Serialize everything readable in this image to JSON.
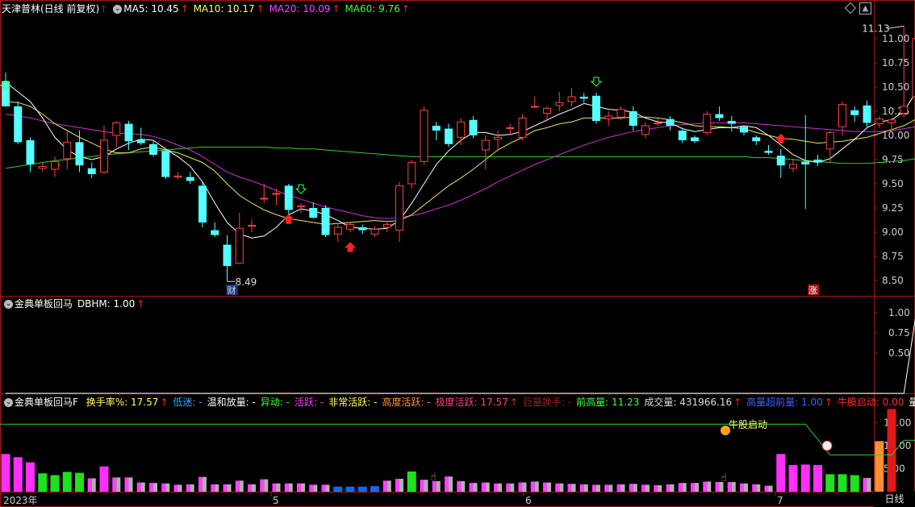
{
  "main_header": {
    "title": "天津普林(日线 前复权)",
    "ma5": "MA5: 10.45",
    "ma10": "MA10: 10.17",
    "ma20": "MA20: 10.09",
    "ma60": "MA60: 9.76",
    "colors": {
      "ma5": "#ffffff",
      "ma10": "#ffff66",
      "ma20": "#ff40ff",
      "ma60": "#40ff40",
      "up": "#ff2020"
    }
  },
  "ind1_header": {
    "name": "金典单板回马",
    "value": "DBHM: 1.00"
  },
  "ind2_header": {
    "name": "金典单板回马F",
    "items": [
      {
        "label": "换手率%: 17.57",
        "color": "#ffff66"
      },
      {
        "label": "低迷: -",
        "color": "#40a0ff"
      },
      {
        "label": "温和放量: -",
        "color": "#ffffff"
      },
      {
        "label": "异动: -",
        "color": "#40ff40"
      },
      {
        "label": "活跃: -",
        "color": "#ff40ff"
      },
      {
        "label": "非常活跃: -",
        "color": "#ffff66"
      },
      {
        "label": "高度活跃: -",
        "color": "#ff9040"
      },
      {
        "label": "极度活跃: 17.57",
        "color": "#ff4080"
      },
      {
        "label": "巨量换手: -",
        "color": "#a02020"
      },
      {
        "label": "前高量: 11.23",
        "color": "#40ff40"
      },
      {
        "label": "成交量: 431966.16",
        "color": "#dddddd"
      },
      {
        "label": "高量超前量: 1.00",
        "color": "#4060ff"
      },
      {
        "label": "牛股启动: 0.00",
        "color": "#ff3030"
      },
      {
        "label": "量比:",
        "color": "#ffffff"
      }
    ]
  },
  "price_axis": [
    "11.00",
    "10.75",
    "10.50",
    "10.25",
    "10.00",
    "9.75",
    "9.50",
    "9.25",
    "9.00",
    "8.75",
    "8.50"
  ],
  "ind1_axis": [
    "1.00",
    "0.75",
    "0.50"
  ],
  "ind2_axis": [
    "15.00",
    "10.00",
    "5.00"
  ],
  "x_axis": [
    "2023年",
    "5",
    "6",
    "7"
  ],
  "timeframe": "日线",
  "annotations": {
    "high": "11.13",
    "low": "8.49",
    "cai": "财",
    "zhang": "涨",
    "niugu": "牛股启动"
  },
  "chart_data": {
    "type": "candlestick",
    "ylim": [
      8.38,
      11.22
    ],
    "candles": [
      [
        10.56,
        10.3,
        10.42,
        10.65
      ],
      [
        10.3,
        9.93,
        9.91,
        10.35
      ],
      [
        9.95,
        9.7,
        9.62,
        9.98
      ],
      [
        9.66,
        9.68,
        9.63,
        9.72
      ],
      [
        9.65,
        9.73,
        9.57,
        9.78
      ],
      [
        9.76,
        9.93,
        9.65,
        10.05
      ],
      [
        9.93,
        9.69,
        9.62,
        10.05
      ],
      [
        9.66,
        9.6,
        9.56,
        9.72
      ],
      [
        9.62,
        9.95,
        9.6,
        10.1
      ],
      [
        10.0,
        10.13,
        9.88,
        10.15
      ],
      [
        10.12,
        9.94,
        9.85,
        10.15
      ],
      [
        9.96,
        9.92,
        9.9,
        10.08
      ],
      [
        9.91,
        9.8,
        9.78,
        9.94
      ],
      [
        9.84,
        9.57,
        9.55,
        9.87
      ],
      [
        9.57,
        9.58,
        9.55,
        9.62
      ],
      [
        9.57,
        9.53,
        9.5,
        9.62
      ],
      [
        9.48,
        9.1,
        9.05,
        9.51
      ],
      [
        9.02,
        8.97,
        8.95,
        9.1
      ],
      [
        8.87,
        8.65,
        8.49,
        8.97
      ],
      [
        8.68,
        9.04,
        8.68,
        9.2
      ],
      [
        9.07,
        9.07,
        9.0,
        9.13
      ],
      [
        9.35,
        9.35,
        9.3,
        9.5
      ],
      [
        9.4,
        9.4,
        9.28,
        9.45
      ],
      [
        9.48,
        9.23,
        9.15,
        9.5
      ],
      [
        9.27,
        9.27,
        9.2,
        9.3
      ],
      [
        9.25,
        9.15,
        9.14,
        9.31
      ],
      [
        9.25,
        8.97,
        8.95,
        9.28
      ],
      [
        8.98,
        9.05,
        8.9,
        9.08
      ],
      [
        9.03,
        9.08,
        9.0,
        9.11
      ],
      [
        9.05,
        9.02,
        8.98,
        9.08
      ],
      [
        8.98,
        9.03,
        8.95,
        9.06
      ],
      [
        9.05,
        9.08,
        9.0,
        9.1
      ],
      [
        9.02,
        9.48,
        8.9,
        9.52
      ],
      [
        9.5,
        9.72,
        9.45,
        9.75
      ],
      [
        9.73,
        10.26,
        9.7,
        10.3
      ],
      [
        10.1,
        10.05,
        9.95,
        10.14
      ],
      [
        10.07,
        9.91,
        9.88,
        10.12
      ],
      [
        9.98,
        10.14,
        9.9,
        10.18
      ],
      [
        10.16,
        10.0,
        9.97,
        10.2
      ],
      [
        9.85,
        9.95,
        9.65,
        10.0
      ],
      [
        9.96,
        9.98,
        9.85,
        10.05
      ],
      [
        10.08,
        10.08,
        10.01,
        10.12
      ],
      [
        9.98,
        10.18,
        9.95,
        10.22
      ],
      [
        10.3,
        10.3,
        10.28,
        10.4
      ],
      [
        10.23,
        10.28,
        10.14,
        10.3
      ],
      [
        10.31,
        10.34,
        10.25,
        10.45
      ],
      [
        10.35,
        10.4,
        10.3,
        10.49
      ],
      [
        10.4,
        10.38,
        10.34,
        10.44
      ],
      [
        10.41,
        10.15,
        10.12,
        10.44
      ],
      [
        10.17,
        10.2,
        10.1,
        10.25
      ],
      [
        10.19,
        10.27,
        10.16,
        10.3
      ],
      [
        10.25,
        10.1,
        10.05,
        10.3
      ],
      [
        10.01,
        10.1,
        9.97,
        10.14
      ],
      [
        10.13,
        10.13,
        10.1,
        10.18
      ],
      [
        10.17,
        10.1,
        10.05,
        10.2
      ],
      [
        10.05,
        9.95,
        9.92,
        10.08
      ],
      [
        9.98,
        9.94,
        9.92,
        10.0
      ],
      [
        10.03,
        10.22,
        10.0,
        10.25
      ],
      [
        10.22,
        10.18,
        10.15,
        10.3
      ],
      [
        10.15,
        10.12,
        10.04,
        10.2
      ],
      [
        10.09,
        10.03,
        10.0,
        10.1
      ],
      [
        9.98,
        9.94,
        9.9,
        10.0
      ],
      [
        9.84,
        9.82,
        9.8,
        9.9
      ],
      [
        9.79,
        9.69,
        9.56,
        9.86
      ],
      [
        9.66,
        9.7,
        9.62,
        9.76
      ],
      [
        9.73,
        9.7,
        9.24,
        10.21
      ],
      [
        9.75,
        9.72,
        9.68,
        9.8
      ],
      [
        9.86,
        10.03,
        9.72,
        10.05
      ],
      [
        10.09,
        10.32,
        10.0,
        10.35
      ],
      [
        10.26,
        10.21,
        10.14,
        10.3
      ],
      [
        10.31,
        10.13,
        10.09,
        10.36
      ],
      [
        10.12,
        10.17,
        10.08,
        10.2
      ],
      [
        10.13,
        10.16,
        10.05,
        10.18
      ],
      [
        10.23,
        10.3,
        10.18,
        11.13
      ],
      [
        10.4,
        11.0,
        10.25,
        11.0
      ]
    ],
    "ma5": [
      10.55,
      10.45,
      10.35,
      10.18,
      9.98,
      9.85,
      9.78,
      9.75,
      9.78,
      9.86,
      9.92,
      9.96,
      9.95,
      9.86,
      9.78,
      9.68,
      9.52,
      9.3,
      9.1,
      8.98,
      8.94,
      8.96,
      9.05,
      9.18,
      9.24,
      9.22,
      9.18,
      9.12,
      9.05,
      9.04,
      9.03,
      9.04,
      9.12,
      9.3,
      9.5,
      9.7,
      9.84,
      9.95,
      10.03,
      10.03,
      10.0,
      10.01,
      10.04,
      10.1,
      10.16,
      10.22,
      10.27,
      10.33,
      10.3,
      10.27,
      10.26,
      10.24,
      10.18,
      10.14,
      10.13,
      10.07,
      10.04,
      10.06,
      10.08,
      10.08,
      10.1,
      10.08,
      10.0,
      9.9,
      9.8,
      9.74,
      9.72,
      9.76,
      9.86,
      9.96,
      10.08,
      10.14,
      10.16,
      10.25,
      10.45
    ],
    "ma10": [
      10.35,
      10.34,
      10.3,
      10.22,
      10.12,
      10.05,
      9.98,
      9.92,
      9.86,
      9.82,
      9.82,
      9.86,
      9.88,
      9.85,
      9.82,
      9.77,
      9.72,
      9.63,
      9.5,
      9.38,
      9.3,
      9.23,
      9.18,
      9.14,
      9.12,
      9.1,
      9.08,
      9.09,
      9.1,
      9.11,
      9.12,
      9.11,
      9.12,
      9.18,
      9.28,
      9.38,
      9.48,
      9.56,
      9.65,
      9.75,
      9.85,
      9.92,
      9.98,
      10.05,
      10.08,
      10.12,
      10.14,
      10.18,
      10.18,
      10.18,
      10.18,
      10.19,
      10.19,
      10.18,
      10.16,
      10.13,
      10.1,
      10.09,
      10.09,
      10.08,
      10.07,
      10.03,
      10.0,
      9.97,
      9.96,
      9.94,
      9.92,
      9.93,
      9.94,
      9.96,
      9.98,
      10.02,
      10.06,
      10.1,
      10.17
    ],
    "ma20": [
      10.22,
      10.2,
      10.18,
      10.15,
      10.12,
      10.1,
      10.08,
      10.06,
      10.04,
      10.02,
      10.02,
      10.01,
      9.99,
      9.95,
      9.9,
      9.85,
      9.78,
      9.7,
      9.62,
      9.57,
      9.53,
      9.48,
      9.43,
      9.38,
      9.34,
      9.3,
      9.26,
      9.23,
      9.2,
      9.17,
      9.15,
      9.14,
      9.15,
      9.17,
      9.2,
      9.24,
      9.28,
      9.33,
      9.39,
      9.45,
      9.52,
      9.58,
      9.64,
      9.7,
      9.75,
      9.8,
      9.85,
      9.9,
      9.94,
      9.98,
      10.01,
      10.04,
      10.06,
      10.08,
      10.1,
      10.11,
      10.12,
      10.13,
      10.13,
      10.13,
      10.13,
      10.12,
      10.11,
      10.1,
      10.09,
      10.08,
      10.07,
      10.06,
      10.05,
      10.04,
      10.04,
      10.04,
      10.05,
      10.07,
      10.09
    ],
    "ma60": [
      9.66,
      9.68,
      9.7,
      9.72,
      9.74,
      9.75,
      9.77,
      9.78,
      9.8,
      9.81,
      9.82,
      9.83,
      9.84,
      9.85,
      9.86,
      9.87,
      9.88,
      9.88,
      9.88,
      9.88,
      9.88,
      9.88,
      9.87,
      9.87,
      9.86,
      9.86,
      9.85,
      9.84,
      9.83,
      9.82,
      9.81,
      9.8,
      9.79,
      9.78,
      9.78,
      9.78,
      9.78,
      9.78,
      9.78,
      9.78,
      9.78,
      9.78,
      9.78,
      9.78,
      9.78,
      9.78,
      9.78,
      9.78,
      9.78,
      9.78,
      9.78,
      9.78,
      9.78,
      9.78,
      9.78,
      9.78,
      9.78,
      9.78,
      9.78,
      9.78,
      9.78,
      9.77,
      9.77,
      9.76,
      9.75,
      9.74,
      9.73,
      9.72,
      9.71,
      9.71,
      9.71,
      9.72,
      9.73,
      9.74,
      9.76
    ],
    "dbhm": {
      "ylim": [
        0,
        1.1
      ],
      "last": 1.0
    },
    "volume": {
      "ylim": [
        0,
        19
      ],
      "values": [
        8.2,
        7.5,
        6.4,
        4.0,
        3.6,
        4.3,
        4.1,
        2.9,
        5.5,
        3.1,
        3.1,
        2.0,
        1.9,
        1.8,
        1.5,
        1.6,
        3.2,
        1.6,
        1.6,
        2.4,
        1.6,
        2.7,
        1.8,
        1.8,
        1.8,
        1.5,
        1.5,
        1.1,
        1.1,
        1.1,
        1.2,
        2.4,
        2.8,
        4.4,
        2.6,
        2.3,
        3.3,
        2.3,
        1.9,
        2.0,
        1.8,
        1.8,
        2.0,
        2.2,
        2.0,
        1.8,
        1.7,
        1.6,
        1.5,
        1.5,
        1.6,
        1.7,
        1.5,
        1.4,
        1.6,
        1.9,
        1.9,
        2.2,
        2.1,
        2.1,
        1.8,
        1.6,
        1.3,
        8.2,
        5.8,
        5.9,
        5.8,
        3.8,
        3.8,
        3.6,
        3.0,
        11.0,
        18.0
      ],
      "colors": [
        "m",
        "m",
        "m",
        "g",
        "g",
        "g",
        "g",
        "p",
        "m",
        "p",
        "p",
        "p",
        "p",
        "p",
        "p",
        "p",
        "p",
        "p",
        "p",
        "p",
        "p",
        "p",
        "p",
        "p",
        "p",
        "p",
        "p",
        "b",
        "b",
        "b",
        "b",
        "p",
        "p",
        "g",
        "p",
        "p",
        "p",
        "p",
        "p",
        "p",
        "p",
        "p",
        "p",
        "p",
        "p",
        "p",
        "p",
        "p",
        "p",
        "p",
        "p",
        "p",
        "p",
        "p",
        "p",
        "p",
        "p",
        "p",
        "p",
        "p",
        "p",
        "p",
        "p",
        "m",
        "m",
        "m",
        "m",
        "g",
        "g",
        "g",
        "p",
        "o",
        "r"
      ],
      "ref_line": 14.7,
      "niugu_line": [
        [
          60,
          14.7
        ],
        [
          65,
          14.7
        ],
        [
          67,
          8.0
        ],
        [
          72,
          8.0
        ],
        [
          73,
          11.2
        ],
        [
          74,
          11.2
        ]
      ]
    }
  }
}
